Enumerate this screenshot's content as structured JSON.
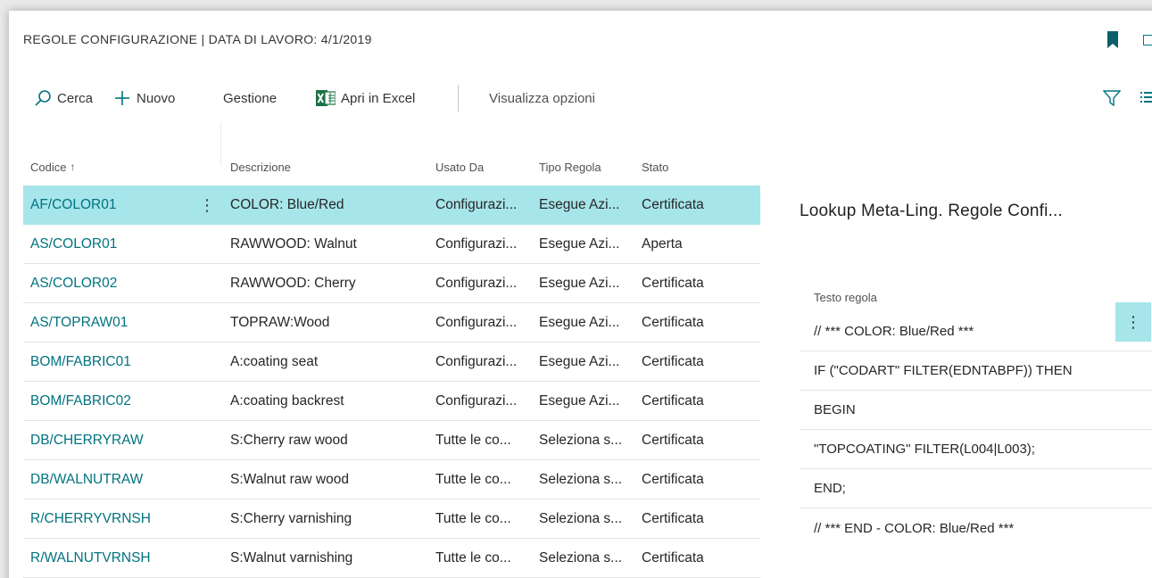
{
  "header": {
    "title": "REGOLE CONFIGURAZIONE | DATA DI LAVORO: 4/1/2019"
  },
  "actions": {
    "search": "Cerca",
    "new": "Nuovo",
    "manage": "Gestione",
    "excel": "Apri in Excel",
    "show_options": "Visualizza opzioni"
  },
  "columns": {
    "code": "Codice",
    "description": "Descrizione",
    "used_by": "Usato Da",
    "rule_type": "Tipo Regola",
    "status": "Stato"
  },
  "rows": [
    {
      "code": "AF/COLOR01",
      "description": "COLOR: Blue/Red",
      "used_by": "Configurazi...",
      "rule_type": "Esegue Azi...",
      "status": "Certificata"
    },
    {
      "code": "AS/COLOR01",
      "description": "RAWWOOD: Walnut",
      "used_by": "Configurazi...",
      "rule_type": "Esegue Azi...",
      "status": "Aperta"
    },
    {
      "code": "AS/COLOR02",
      "description": "RAWWOOD: Cherry",
      "used_by": "Configurazi...",
      "rule_type": "Esegue Azi...",
      "status": "Certificata"
    },
    {
      "code": "AS/TOPRAW01",
      "description": "TOPRAW:Wood",
      "used_by": "Configurazi...",
      "rule_type": "Esegue Azi...",
      "status": "Certificata"
    },
    {
      "code": "BOM/FABRIC01",
      "description": "A:coating seat",
      "used_by": "Configurazi...",
      "rule_type": "Esegue Azi...",
      "status": "Certificata"
    },
    {
      "code": "BOM/FABRIC02",
      "description": "A:coating backrest",
      "used_by": "Configurazi...",
      "rule_type": "Esegue Azi...",
      "status": "Certificata"
    },
    {
      "code": "DB/CHERRYRAW",
      "description": "S:Cherry raw wood",
      "used_by": "Tutte le co...",
      "rule_type": "Seleziona s...",
      "status": "Certificata"
    },
    {
      "code": "DB/WALNUTRAW",
      "description": "S:Walnut raw wood",
      "used_by": "Tutte le co...",
      "rule_type": "Seleziona s...",
      "status": "Certificata"
    },
    {
      "code": "R/CHERRYVRNSH",
      "description": "S:Cherry varnishing",
      "used_by": "Tutte le co...",
      "rule_type": "Seleziona s...",
      "status": "Certificata"
    },
    {
      "code": "R/WALNUTVRNSH",
      "description": "S:Walnut varnishing",
      "used_by": "Tutte le co...",
      "rule_type": "Seleziona s...",
      "status": "Certificata"
    }
  ],
  "factbox": {
    "title": "Lookup Meta-Ling. Regole Confi...",
    "column": "Testo regola",
    "lines": [
      "// *** COLOR: Blue/Red ***",
      "IF (\"CODART\" FILTER(EDNTABPF)) THEN",
      "BEGIN",
      "\"TOPCOATING\" FILTER(L004|L003);",
      "END;",
      "// *** END - COLOR: Blue/Red ***"
    ]
  },
  "colors": {
    "accent": "#00737f",
    "selected_row": "#a6e5ea",
    "bookmark": "#0c5f6b"
  }
}
